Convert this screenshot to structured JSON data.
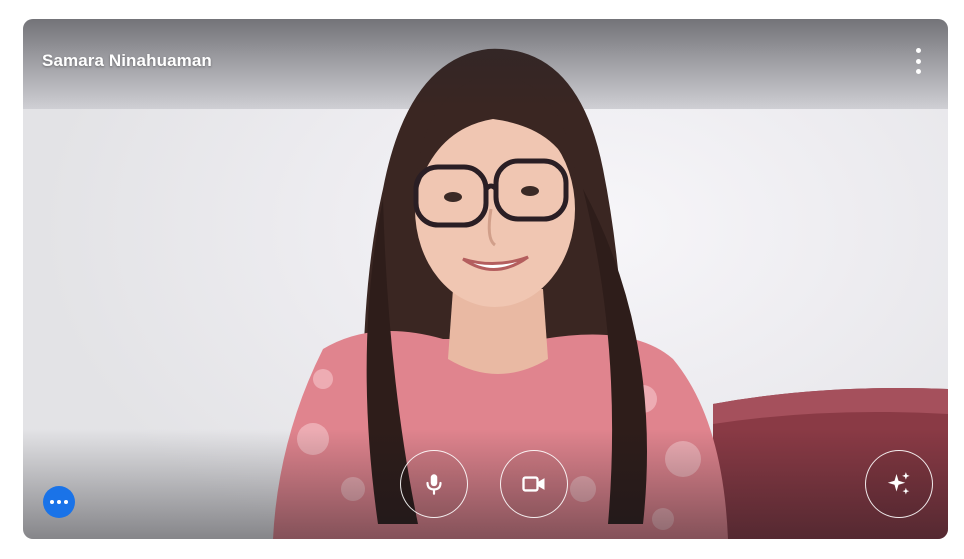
{
  "participant": {
    "name": "Samara Ninahuaman"
  },
  "icons": {
    "menu": "more-vertical-icon",
    "mic": "microphone-icon",
    "camera": "video-camera-icon",
    "effects": "sparkle-icon",
    "more": "more-horizontal-icon"
  },
  "colors": {
    "more_button": "#1a73e8",
    "overlay_text": "#ffffff"
  }
}
